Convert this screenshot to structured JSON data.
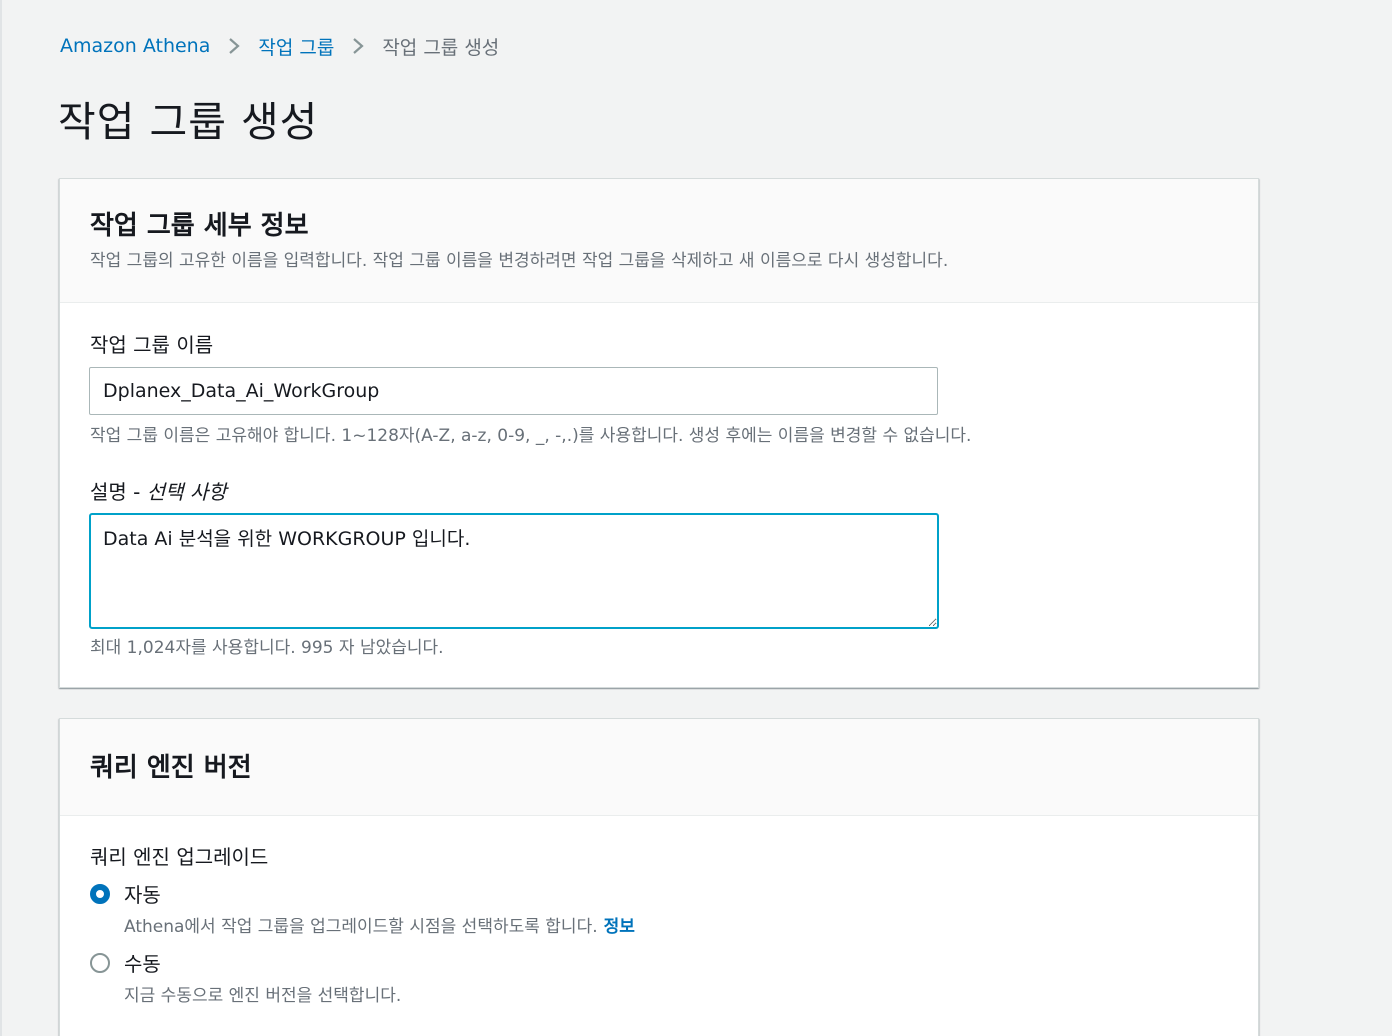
{
  "breadcrumb": {
    "items": [
      "Amazon Athena",
      "작업 그룹",
      "작업 그룹 생성"
    ]
  },
  "page_title": "작업 그룹 생성",
  "details_panel": {
    "title": "작업 그룹 세부 정보",
    "description": "작업 그룹의 고유한 이름을 입력합니다. 작업 그룹 이름을 변경하려면 작업 그룹을 삭제하고 새 이름으로 다시 생성합니다.",
    "name_label": "작업 그룹 이름",
    "name_value": "Dplanex_Data_Ai_WorkGroup",
    "name_hint": "작업 그룹 이름은 고유해야 합니다. 1~128자(A-Z, a-z, 0-9, _, -,.)를 사용합니다. 생성 후에는 이름을 변경할 수 없습니다.",
    "desc_label": "설명 -",
    "desc_optional": "선택 사항",
    "desc_value": "Data Ai 분석을 위한 WORKGROUP 입니다.",
    "desc_hint": "최대 1,024자를 사용합니다. 995 자 남았습니다."
  },
  "engine_panel": {
    "title": "쿼리 엔진 버전",
    "upgrade_label": "쿼리 엔진 업그레이드",
    "options": [
      {
        "label": "자동",
        "description": "Athena에서 작업 그룹을 업그레이드할 시점을 선택하도록 합니다.",
        "info": "정보",
        "selected": true
      },
      {
        "label": "수동",
        "description": "지금 수동으로 엔진 버전을 선택합니다.",
        "selected": false
      }
    ]
  },
  "colors": {
    "link": "#0073bb",
    "focus_border": "#00a1c9",
    "background": "#f2f3f3"
  }
}
